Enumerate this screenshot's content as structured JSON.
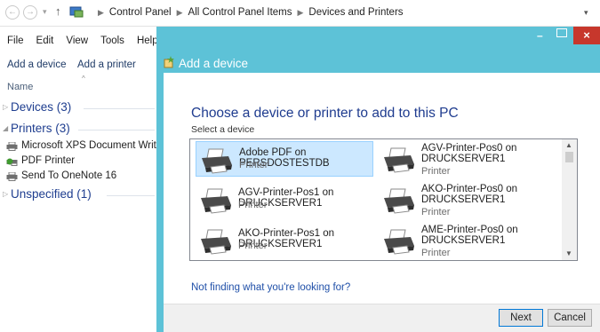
{
  "addressbar": {
    "back_icon": "back-arrow-icon",
    "forward_icon": "forward-arrow-icon",
    "crumbs": [
      "Control Panel",
      "All Control Panel Items",
      "Devices and Printers"
    ]
  },
  "menu": {
    "file": "File",
    "edit": "Edit",
    "view": "View",
    "tools": "Tools",
    "help": "Help"
  },
  "commandbar": {
    "add_device": "Add a device",
    "add_printer": "Add a printer"
  },
  "column_header": "Name",
  "groups": {
    "devices": "Devices (3)",
    "printers": "Printers (3)",
    "unspecified": "Unspecified (1)"
  },
  "printers_list": [
    {
      "label": "Microsoft XPS Document Writer",
      "icon": "printer-icon"
    },
    {
      "label": "PDF Printer",
      "icon": "pdf-printer-icon"
    },
    {
      "label": "Send To OneNote 16",
      "icon": "printer-icon"
    }
  ],
  "dialog": {
    "title": "Add a device",
    "heading": "Choose a device or printer to add to this PC",
    "subheading": "Select a device",
    "items": [
      {
        "name": "Adobe PDF on PERSDOSTESTDB",
        "type": "Printer",
        "selected": true
      },
      {
        "name": "AGV-Printer-Pos0 on DRUCKSERVER1",
        "type": "Printer",
        "selected": false
      },
      {
        "name": "AGV-Printer-Pos1 on DRUCKSERVER1",
        "type": "Printer",
        "selected": false
      },
      {
        "name": "AKO-Printer-Pos0 on DRUCKSERVER1",
        "type": "Printer",
        "selected": false
      },
      {
        "name": "AKO-Printer-Pos1 on DRUCKSERVER1",
        "type": "Printer",
        "selected": false
      },
      {
        "name": "AME-Printer-Pos0 on DRUCKSERVER1",
        "type": "Printer",
        "selected": false
      }
    ],
    "help_link": "Not finding what you're looking for?",
    "next": "Next",
    "cancel": "Cancel"
  },
  "colors": {
    "dialog_accent": "#5dc2d7",
    "heading": "#1f3c8f",
    "selection": "#cce8ff",
    "close": "#c7372c"
  }
}
